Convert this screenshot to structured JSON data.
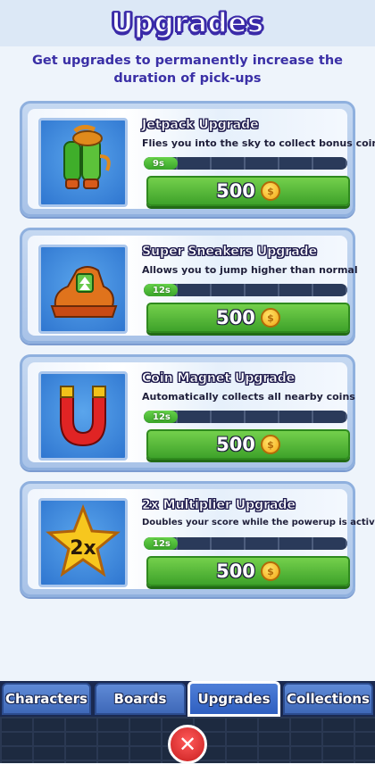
{
  "header": {
    "title": "Upgrades",
    "subtitle": "Get upgrades to permanently increase the duration of pick-ups"
  },
  "upgrades": [
    {
      "title": "Jetpack Upgrade",
      "description": "Flies you into the sky to collect bonus coins",
      "duration_label": "9s",
      "price": "500",
      "icon": "jetpack-icon",
      "level_fraction": 0.166
    },
    {
      "title": "Super Sneakers Upgrade",
      "description": "Allows you to jump higher than normal",
      "duration_label": "12s",
      "price": "500",
      "icon": "sneakers-icon",
      "level_fraction": 0.166
    },
    {
      "title": "Coin Magnet Upgrade",
      "description": "Automatically collects all nearby coins",
      "duration_label": "12s",
      "price": "500",
      "icon": "magnet-icon",
      "level_fraction": 0.166
    },
    {
      "title": "2x Multiplier Upgrade",
      "description": "Doubles your score while the powerup is active",
      "duration_label": "12s",
      "price": "500",
      "icon": "star-2x-icon",
      "star_text": "2x",
      "level_fraction": 0.166
    }
  ],
  "tabs": [
    {
      "label": "Characters",
      "active": false
    },
    {
      "label": "Boards",
      "active": false
    },
    {
      "label": "Upgrades",
      "active": true
    },
    {
      "label": "Collections",
      "active": false
    }
  ],
  "colors": {
    "title_outline": "#3a2aa8",
    "buy_button": "#4fb534",
    "tab_active_border": "#ffffff",
    "close_button": "#e33232"
  }
}
